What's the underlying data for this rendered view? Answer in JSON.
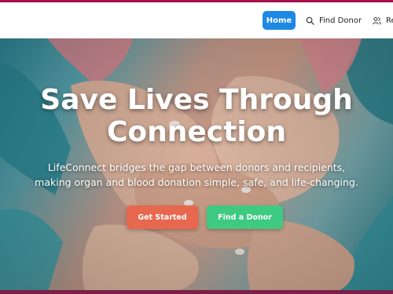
{
  "nav": {
    "home_label": "Home",
    "find_donor_label": "Find Donor",
    "register_label": "Re",
    "icons": {
      "find_donor": "search-icon",
      "register": "users-icon"
    }
  },
  "hero": {
    "title": "Save Lives Through Connection",
    "subtitle": "LifeConnect bridges the gap between donors and recipients, making organ and blood donation simple, safe, and life-changing.",
    "primary_button": "Get Started",
    "secondary_button": "Find a Donor",
    "image": "stacked-hands-photo"
  },
  "colors": {
    "top_bar": "#a3124a",
    "home_button": "#1e88e5",
    "get_started": "#e8674f",
    "find_donor": "#3fca82",
    "bottom_strip": "#7a2048"
  }
}
